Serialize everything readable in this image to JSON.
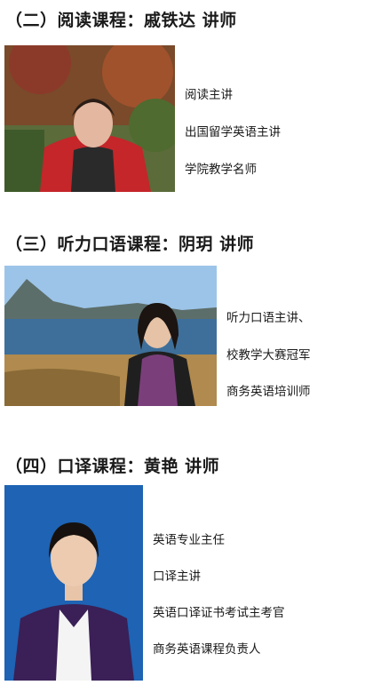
{
  "sections": [
    {
      "heading": "（二）阅读课程：戚铁达  讲师",
      "lines": [
        "阅读主讲",
        "出国留学英语主讲",
        "学院教学名师"
      ]
    },
    {
      "heading": "（三）听力口语课程：阴玥  讲师",
      "lines": [
        "听力口语主讲、",
        "校教学大赛冠军",
        "商务英语培训师"
      ]
    },
    {
      "heading": "（四）口译课程：黄艳  讲师",
      "lines": [
        "英语专业主任",
        "口译主讲",
        "英语口译证书考试主考官",
        "商务英语课程负责人"
      ]
    }
  ]
}
